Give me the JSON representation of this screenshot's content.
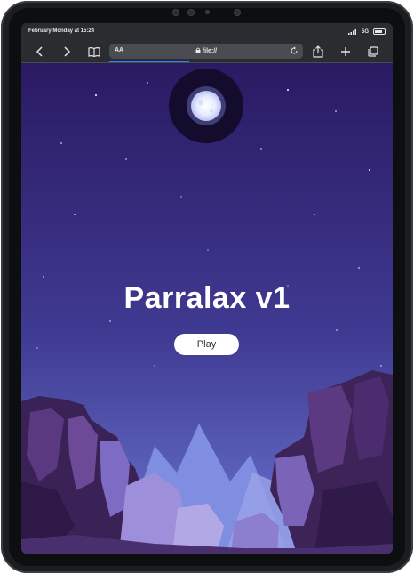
{
  "status_bar": {
    "time": "February Monday at 15:24",
    "network": "5G"
  },
  "browser": {
    "reader_label": "AA",
    "url": "file://",
    "icons": [
      "back-icon",
      "forward-icon",
      "bookmarks-icon",
      "lock-icon",
      "reload-icon",
      "share-icon",
      "plus-icon",
      "tabs-icon"
    ]
  },
  "page": {
    "title": "Parralax v1",
    "play_label": "Play"
  },
  "colors": {
    "sky_top": "#2c1c66",
    "sky_bottom": "#5f66c4",
    "moon": "#f4f6ff",
    "rock_dark": "#3a2156",
    "rock_light": "#7e6cc4"
  }
}
